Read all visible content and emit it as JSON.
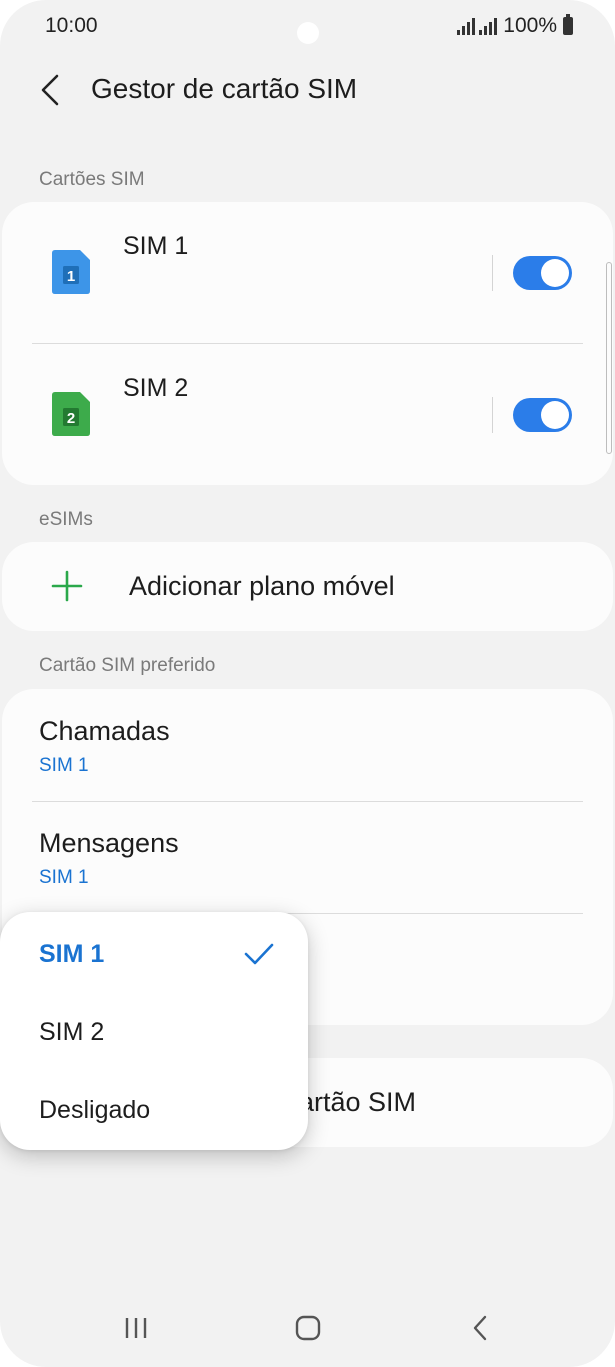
{
  "status_bar": {
    "time": "10:00",
    "battery": "100%"
  },
  "header": {
    "title": "Gestor de cartão SIM"
  },
  "sections": {
    "sim_cards": "Cartões SIM",
    "esims": "eSIMs",
    "preferred": "Cartão SIM preferido"
  },
  "sim_cards": [
    {
      "name": "SIM 1",
      "badge": "1",
      "color": "#3d95e8",
      "enabled": true
    },
    {
      "name": "SIM 2",
      "badge": "2",
      "color": "#3dab4b",
      "enabled": true
    }
  ],
  "esim": {
    "add_label": "Adicionar plano móvel",
    "icon": "plus-icon",
    "icon_color": "#2aa84a"
  },
  "preferred": {
    "rows": [
      {
        "title": "Chamadas",
        "value": "SIM 1"
      },
      {
        "title": "Mensagens",
        "value": "SIM 1"
      }
    ]
  },
  "lower_card": {
    "label_visible": "artão SIM"
  },
  "popup": {
    "options": [
      {
        "label": "SIM 1",
        "selected": true
      },
      {
        "label": "SIM 2",
        "selected": false
      },
      {
        "label": "Desligado",
        "selected": false
      }
    ]
  },
  "colors": {
    "accent": "#1a73d1",
    "toggle_on": "#2b7de9",
    "background": "#f2f2f2"
  },
  "navbar": {
    "icons": [
      "recent-apps-icon",
      "home-icon",
      "back-icon"
    ]
  }
}
